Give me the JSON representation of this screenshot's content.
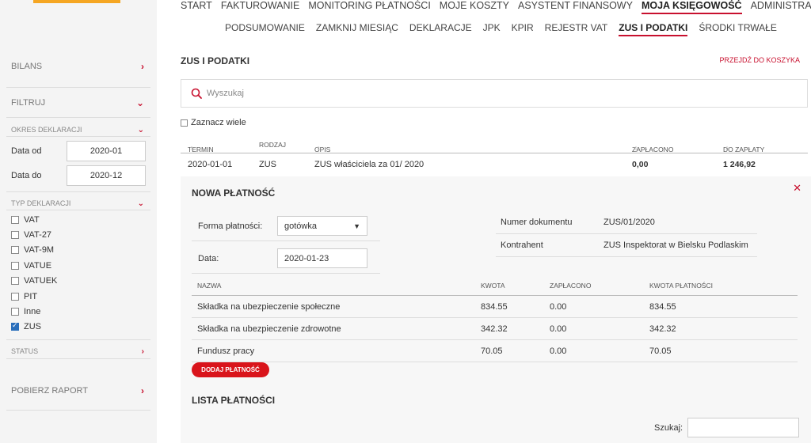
{
  "sidebar": {
    "bilans": "BILANS",
    "filtruj": "FILTRUJ",
    "okres_deklaracji": "OKRES DEKLARACJI",
    "data_od_label": "Data od",
    "data_od_value": "2020-01",
    "data_do_label": "Data do",
    "data_do_value": "2020-12",
    "typ_deklaracji": "TYP DEKLARACJI",
    "types": [
      {
        "label": "VAT",
        "checked": false
      },
      {
        "label": "VAT-27",
        "checked": false
      },
      {
        "label": "VAT-9M",
        "checked": false
      },
      {
        "label": "VATUE",
        "checked": false
      },
      {
        "label": "VATUEK",
        "checked": false
      },
      {
        "label": "PIT",
        "checked": false
      },
      {
        "label": "Inne",
        "checked": false
      },
      {
        "label": "ZUS",
        "checked": true
      }
    ],
    "status": "STATUS",
    "pobierz_raport": "POBIERZ RAPORT"
  },
  "topnav": [
    "START",
    "FAKTUROWANIE",
    "MONITORING PŁATNOŚCI",
    "MOJE KOSZTY",
    "ASYSTENT FINANSOWY",
    "MOJA KSIĘGOWOŚĆ",
    "ADMINISTRACJA"
  ],
  "topnav_active": "MOJA KSIĘGOWOŚĆ",
  "subnav": [
    "PODSUMOWANIE",
    "ZAMKNIJ MIESIĄC",
    "DEKLARACJE",
    "JPK",
    "KPIR",
    "REJESTR VAT",
    "ZUS I PODATKI",
    "ŚRODKI TRWAŁE"
  ],
  "subnav_active": "ZUS I PODATKI",
  "page": {
    "title": "ZUS I PODATKI",
    "cart_link": "PRZEJDŹ DO KOSZYKA",
    "search_placeholder": "Wyszukaj",
    "select_many": "Zaznacz wiele"
  },
  "table": {
    "headers": {
      "termin": "TERMIN",
      "rodzaj": "RODZAJ",
      "opis": "OPIS",
      "zaplacono": "ZAPŁACONO",
      "do_zaplaty": "DO ZAPŁATY"
    },
    "rows": [
      {
        "termin": "2020-01-01",
        "rodzaj": "ZUS",
        "opis": "ZUS właściciela za 01/ 2020",
        "zaplacono": "0,00",
        "do_zaplaty": "1 246,92"
      }
    ]
  },
  "payment": {
    "title": "NOWA PŁATNOŚĆ",
    "forma_label": "Forma płatności:",
    "forma_value": "gotówka",
    "data_label": "Data:",
    "data_value": "2020-01-23",
    "numer_label": "Numer dokumentu",
    "numer_value": "ZUS/01/2020",
    "kontrahent_label": "Kontrahent",
    "kontrahent_value": "ZUS Inspektorat w Bielsku Podlaskim",
    "headers": {
      "nazwa": "NAZWA",
      "kwota": "KWOTA",
      "zaplacono": "ZAPŁACONO",
      "kwota_platnosci": "KWOTA PŁATNOŚCI"
    },
    "items": [
      {
        "nazwa": "Składka na ubezpieczenie społeczne",
        "kwota": "834.55",
        "zaplacono": "0.00",
        "kwota_platnosci": "834.55"
      },
      {
        "nazwa": "Składka na ubezpieczenie zdrowotne",
        "kwota": "342.32",
        "zaplacono": "0.00",
        "kwota_platnosci": "342.32"
      },
      {
        "nazwa": "Fundusz pracy",
        "kwota": "70.05",
        "zaplacono": "0.00",
        "kwota_platnosci": "70.05"
      }
    ],
    "add_button": "DODAJ PŁATNOŚĆ",
    "list_title": "LISTA PŁATNOŚCI",
    "search_label": "Szukaj:"
  },
  "colors": {
    "accent": "#c8102e",
    "button": "#d9141b",
    "logo": "#f5a623",
    "checkbox": "#2a6ebb"
  }
}
